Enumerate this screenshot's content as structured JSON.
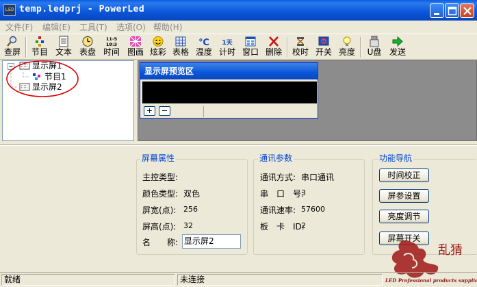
{
  "window": {
    "title": "temp.ledprj - PowerLed",
    "icon_label": "LED",
    "controls": [
      "minimize-icon",
      "maximize-icon",
      "close-icon"
    ]
  },
  "menu": [
    {
      "label": "文件(F)"
    },
    {
      "label": "编辑(E)"
    },
    {
      "label": "工具(T)"
    },
    {
      "label": "选项(O)"
    },
    {
      "label": "帮助(H)"
    }
  ],
  "toolbar": {
    "items": [
      {
        "label": "查屏",
        "icon": "magnifier-icon"
      },
      {
        "label": "节目",
        "icon": "program-icon"
      },
      {
        "label": "文本",
        "icon": "text-doc-icon"
      },
      {
        "label": "表盘",
        "icon": "clock-dial-icon"
      },
      {
        "label": "时间",
        "icon": "time-icon",
        "icon_text": "11-5\n18:3"
      },
      {
        "label": "图画",
        "icon": "picture-icon"
      },
      {
        "label": "炫彩",
        "icon": "smiley-icon"
      },
      {
        "label": "表格",
        "icon": "table-icon"
      },
      {
        "label": "温度",
        "icon": "temperature-icon",
        "icon_text": "℃"
      },
      {
        "label": "计时",
        "icon": "countdown-icon",
        "icon_text": "1天"
      },
      {
        "label": "窗口",
        "icon": "window-icon"
      },
      {
        "label": "删除",
        "icon": "delete-icon"
      },
      {
        "label": "校时",
        "icon": "sync-time-icon"
      },
      {
        "label": "开关",
        "icon": "power-screen-icon"
      },
      {
        "label": "亮度",
        "icon": "bulb-icon"
      },
      {
        "label": "U盘",
        "icon": "usb-disk-icon"
      },
      {
        "label": "发送",
        "icon": "send-arrow-icon"
      }
    ]
  },
  "tree": {
    "nodes": [
      {
        "label": "显示屏1",
        "level": 0,
        "expanded": true
      },
      {
        "label": "节目1",
        "level": 1
      },
      {
        "label": "显示屏2",
        "level": 0,
        "selected": true
      }
    ]
  },
  "preview": {
    "title": "显示屏预览区",
    "zoom_in": "+",
    "zoom_out": "−"
  },
  "screen_props": {
    "title": "屏幕属性",
    "controller_label": "主控类型:",
    "controller_value": "",
    "color_label": "颜色类型:",
    "color_value": "双色",
    "width_label": "屏宽(点):",
    "width_value": "256",
    "height_label": "屏高(点):",
    "height_value": "32",
    "name_label": "名　　称:",
    "name_value": "显示屏2"
  },
  "comm_params": {
    "title": "通讯参数",
    "mode_label": "通讯方式:",
    "mode_value": "串口通讯",
    "port_label": "串　口　号:",
    "port_value": "3",
    "baud_label": "通讯速率:",
    "baud_value": "57600",
    "card_label": "板　卡　ID:",
    "card_value": "2"
  },
  "nav": {
    "title": "功能导航",
    "buttons": [
      "时间校正",
      "屏参设置",
      "亮度调节",
      "屏幕开关"
    ]
  },
  "status": {
    "left": "就绪",
    "middle": "未连接"
  },
  "watermark": {
    "text": "LED Professional products suppliers",
    "glyphs": "乱猜"
  },
  "colors": {
    "title_bar": "#0a55d8",
    "group_title": "#0046d5",
    "annotation_circle": "#e00000",
    "preview_bg": "#8c8c8c"
  }
}
